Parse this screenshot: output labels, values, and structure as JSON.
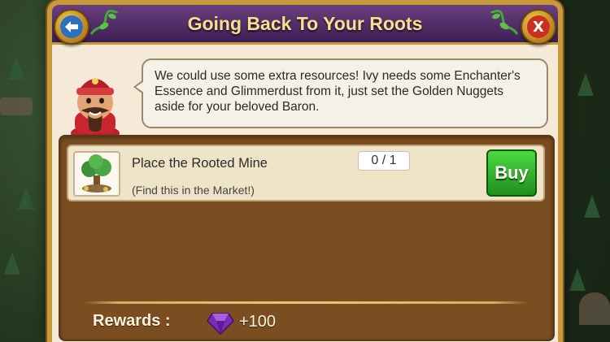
{
  "dialog": {
    "title": "Going Back To Your Roots",
    "back_icon": "back-arrow-icon",
    "close_icon": "close-icon",
    "close_label": "X"
  },
  "speech": {
    "text": "We could use some extra resources! Ivy needs some Enchanter's Essence and Glimmerdust from it, just set the Golden Nuggets aside for your beloved Baron."
  },
  "task": {
    "title": "Place the Rooted Mine",
    "hint": "(Find this in the Market!)",
    "progress": "0 / 1",
    "buy_label": "Buy"
  },
  "rewards": {
    "label": "Rewards :",
    "gem_icon": "purple-gem-icon",
    "value": "+100"
  },
  "colors": {
    "title_bar": "#4a2766",
    "title_text": "#f7e08a",
    "panel": "#7a4e21",
    "buy_green": "#2fb22a"
  }
}
